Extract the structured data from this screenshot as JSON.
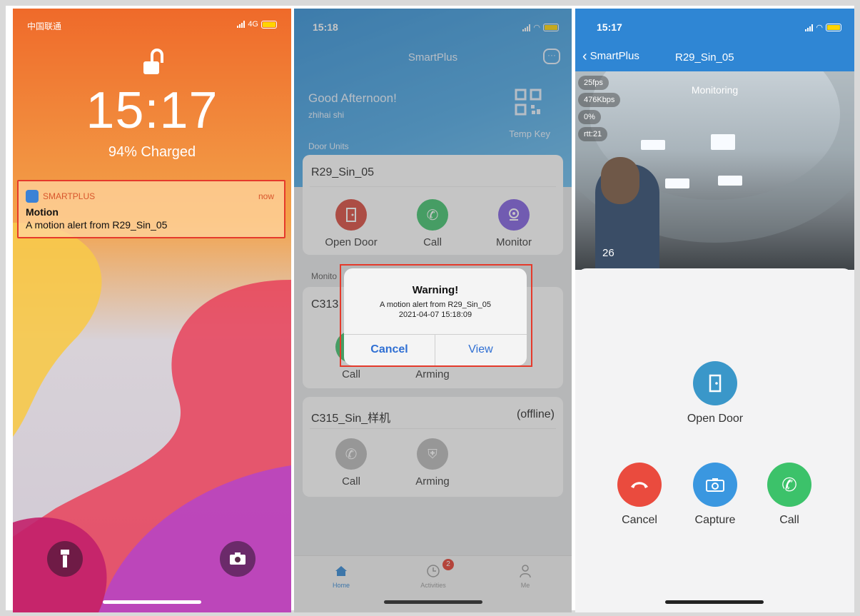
{
  "lock": {
    "carrier": "中国联通",
    "network": "4G",
    "time": "15:17",
    "charge": "94% Charged",
    "notification": {
      "app": "SMARTPLUS",
      "when": "now",
      "title": "Motion",
      "body": "A motion alert from R29_Sin_05"
    }
  },
  "home": {
    "status_time": "15:18",
    "app_title": "SmartPlus",
    "greeting": "Good Afternoon!",
    "user": "zhihai shi",
    "temp_key": "Temp Key",
    "section_doors": "Door Units",
    "section_monitors": "Monito",
    "door_card": {
      "name": "R29_Sin_05",
      "actions": [
        "Open Door",
        "Call",
        "Monitor"
      ]
    },
    "monitor_card": {
      "name": "C313",
      "actions": [
        "Call",
        "Arming"
      ]
    },
    "offline_card": {
      "name": "C315_Sin_样机",
      "status": "(offline)",
      "actions": [
        "Call",
        "Arming"
      ]
    },
    "alert": {
      "title": "Warning!",
      "message": "A motion alert from R29_Sin_05",
      "timestamp": "2021-04-07 15:18:09",
      "cancel": "Cancel",
      "view": "View"
    },
    "tabs": [
      {
        "label": "Home",
        "active": true
      },
      {
        "label": "Activities",
        "badge": "2"
      },
      {
        "label": "Me"
      }
    ]
  },
  "monitor": {
    "status_time": "15:17",
    "back_label": "SmartPlus",
    "title": "R29_Sin_05",
    "video_label": "Monitoring",
    "stats": [
      "25fps",
      "476Kbps",
      "0%",
      "rtt:21"
    ],
    "overlay_num": "26",
    "open_door": "Open Door",
    "controls": [
      "Cancel",
      "Capture",
      "Call"
    ]
  },
  "colors": {
    "accent_blue": "#2f86d4",
    "alert_red": "#e53a2b",
    "call_green": "#3cc26a",
    "hangup_red": "#ea4b3e",
    "monitor_purple": "#7f5ce0",
    "open_door_teal": "#3a97c9"
  }
}
